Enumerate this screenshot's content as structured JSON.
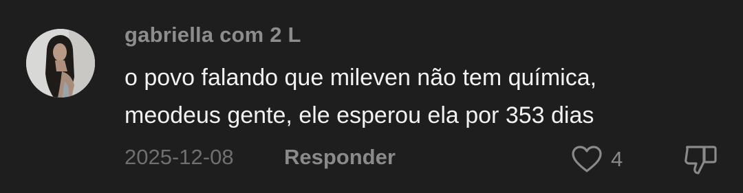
{
  "comment": {
    "username": "gabriella com 2 L",
    "text_lines": [
      "o povo falando que mileven não tem química,",
      "meodeus gente, ele esperou ela por 353 dias"
    ],
    "date": "2025-12-08",
    "reply_label": "Responder",
    "like_count": "4",
    "icons": {
      "like": "heart-outline-icon",
      "dislike": "thumbs-down-outline-icon"
    }
  },
  "colors": {
    "background": "#1e1e1e",
    "username": "#8d8d8d",
    "text": "#f2f2f2",
    "meta": "#8a8a8a"
  }
}
